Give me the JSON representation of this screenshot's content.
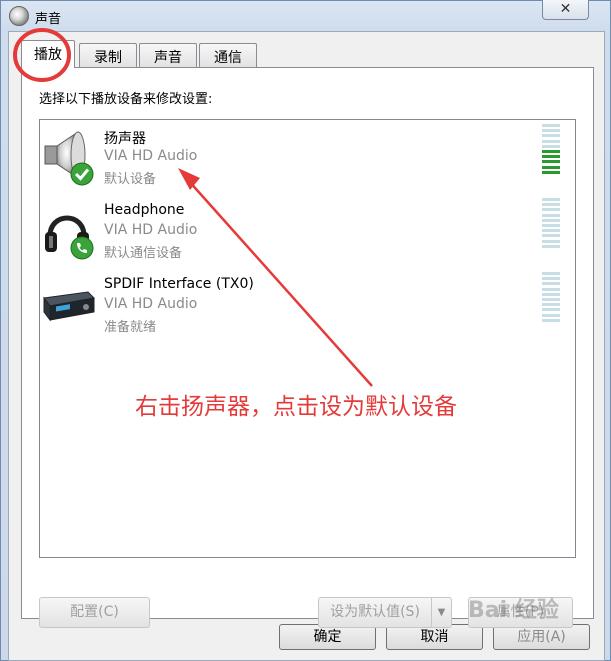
{
  "window": {
    "title": "声音",
    "close_label": "✕"
  },
  "tabs": [
    {
      "label": "播放",
      "active": true
    },
    {
      "label": "录制",
      "active": false
    },
    {
      "label": "声音",
      "active": false
    },
    {
      "label": "通信",
      "active": false
    }
  ],
  "playback": {
    "prompt": "选择以下播放设备来修改设置:",
    "devices": [
      {
        "name": "扬声器",
        "driver": "VIA HD Audio",
        "status": "默认设备",
        "icon": "speaker-icon",
        "badge": "default-check-icon",
        "meter_level": 0.45
      },
      {
        "name": "Headphone",
        "driver": "VIA HD Audio",
        "status": "默认通信设备",
        "icon": "headphone-icon",
        "badge": "phone-badge-icon",
        "meter_level": 0
      },
      {
        "name": "SPDIF Interface (TX0)",
        "driver": "VIA HD Audio",
        "status": "准备就绪",
        "icon": "spdif-device-icon",
        "badge": null,
        "meter_level": 0
      }
    ],
    "buttons": {
      "configure": "配置(C)",
      "set_default": "设为默认值(S)",
      "properties": "属性(P)"
    }
  },
  "footer": {
    "ok": "确定",
    "cancel": "取消",
    "apply": "应用(A)"
  },
  "annotation": {
    "text": "右击扬声器，点击设为默认设备",
    "color": "#e53a3a"
  },
  "watermark": "Bai 经验",
  "colors": {
    "meter_lit": "#2a9a2f",
    "meter_off": "#c9dde4",
    "highlight": "#e53a3a"
  }
}
